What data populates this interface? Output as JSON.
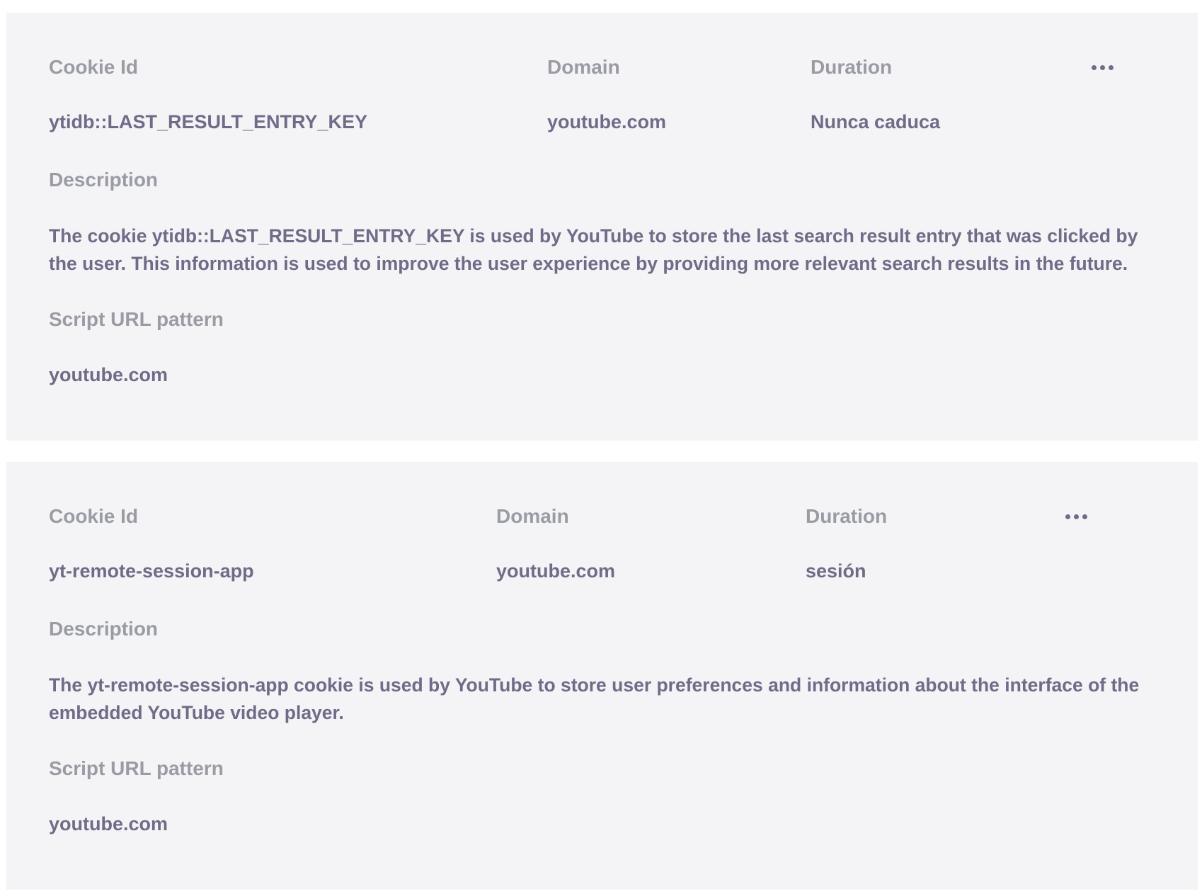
{
  "cookies": [
    {
      "headers": {
        "cookie_id": "Cookie Id",
        "domain": "Domain",
        "duration": "Duration"
      },
      "cookie_id": "ytidb::LAST_RESULT_ENTRY_KEY",
      "domain": "youtube.com",
      "duration": "Nunca caduca",
      "description_label": "Description",
      "description": "The cookie ytidb::LAST_RESULT_ENTRY_KEY is used by YouTube to store the last search result entry that was clicked by the user. This information is used to improve the user experience by providing more relevant search results in the future.",
      "script_url_label": "Script URL pattern",
      "script_url": "youtube.com",
      "more_icon": "more-horizontal-icon"
    },
    {
      "headers": {
        "cookie_id": "Cookie Id",
        "domain": "Domain",
        "duration": "Duration"
      },
      "cookie_id": "yt-remote-session-app",
      "domain": "youtube.com",
      "duration": "sesión",
      "description_label": "Description",
      "description": "The yt-remote-session-app cookie is used by YouTube to store user preferences and information about the interface of the embedded YouTube video player.",
      "script_url_label": "Script URL pattern",
      "script_url": "youtube.com",
      "more_icon": "more-horizontal-icon"
    }
  ],
  "colors": {
    "card_background": "#f4f4f6",
    "label_text": "#9a9ca4",
    "value_text": "#6e6c88"
  }
}
